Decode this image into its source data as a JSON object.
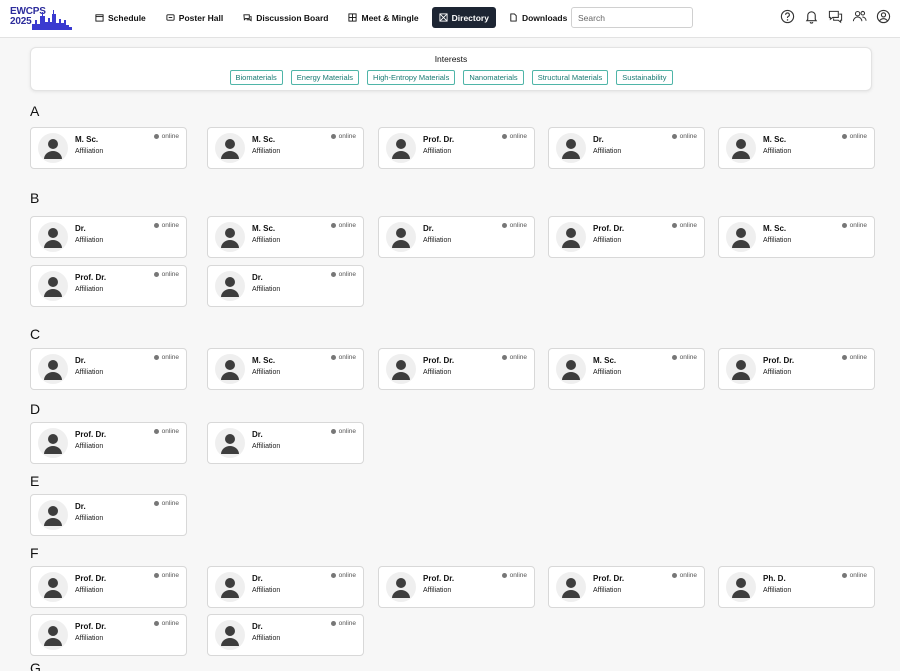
{
  "brand": {
    "line1": "EWCPS",
    "line2": "2025"
  },
  "nav": [
    {
      "label": "Schedule",
      "icon": "calendar-icon"
    },
    {
      "label": "Poster Hall",
      "icon": "poster-icon"
    },
    {
      "label": "Discussion Board",
      "icon": "chat-icon"
    },
    {
      "label": "Meet & Mingle",
      "icon": "grid-icon"
    },
    {
      "label": "Directory",
      "icon": "directory-icon",
      "active": true
    },
    {
      "label": "Downloads",
      "icon": "file-icon"
    }
  ],
  "search": {
    "placeholder": "Search"
  },
  "header_icons": [
    "help-icon",
    "bell-icon",
    "messages-icon",
    "people-icon",
    "account-icon"
  ],
  "interests": {
    "title": "Interests",
    "tags": [
      "Biomaterials",
      "Energy Materials",
      "High-Entropy Materials",
      "Nanomaterials",
      "Structural Materials",
      "Sustainability"
    ]
  },
  "status_label": "online",
  "affiliation_label": "Affiliation",
  "groups": [
    {
      "letter": "A",
      "people": [
        "M. Sc.",
        "M. Sc.",
        "Prof. Dr.",
        "Dr.",
        "M. Sc."
      ]
    },
    {
      "letter": "B",
      "people": [
        "Dr.",
        "M. Sc.",
        "Dr.",
        "Prof. Dr.",
        "M. Sc.",
        "Prof. Dr.",
        "Dr."
      ]
    },
    {
      "letter": "C",
      "people": [
        "Dr.",
        "M. Sc.",
        "Prof. Dr.",
        "M. Sc.",
        "Prof. Dr."
      ]
    },
    {
      "letter": "D",
      "people": [
        "Prof. Dr.",
        "Dr."
      ]
    },
    {
      "letter": "E",
      "people": [
        "Dr."
      ]
    },
    {
      "letter": "F",
      "people": [
        "Prof. Dr.",
        "Dr.",
        "Prof. Dr.",
        "Prof. Dr.",
        "Ph. D.",
        "Prof. Dr.",
        "Dr."
      ]
    },
    {
      "letter": "G",
      "people": []
    }
  ]
}
